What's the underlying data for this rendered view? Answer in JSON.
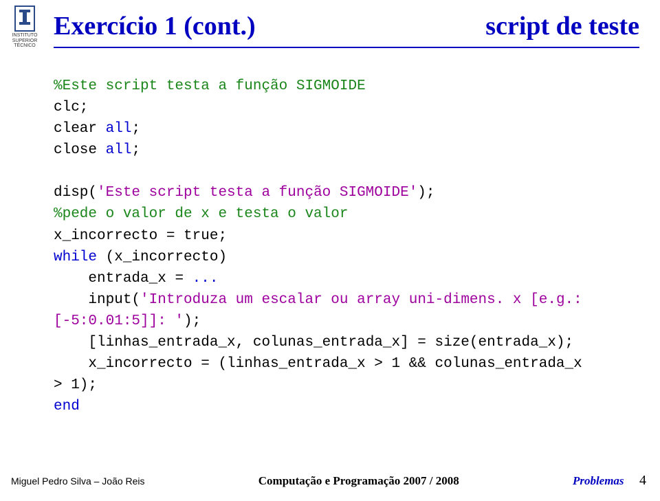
{
  "logo_text": "INSTITUTO SUPERIOR TÉCNICO",
  "title_left": "Exercício 1 (cont.)",
  "title_right": "script de teste",
  "code": {
    "c1": "%Este script testa a função SIGMOIDE",
    "l2": "clc;",
    "l3": "clear ",
    "kw_all1": "all",
    "l3b": ";",
    "l4": "close ",
    "kw_all2": "all",
    "l4b": ";",
    "l6a": "disp(",
    "str1": "'Este script testa a função SIGMOIDE'",
    "l6b": ");",
    "c2": "%pede o valor de x e testa o valor",
    "l8": "x_incorrecto = true;",
    "kw_while": "while",
    "l9": " (x_incorrecto)",
    "l10": "    entrada_x = ",
    "kw_dots": "...",
    "l11a": "    input(",
    "str2": "'Introduza um escalar ou array uni-dimens. x [e.g.: [-5:0.01:5]]: '",
    "l11b": ");",
    "l12": "    [linhas_entrada_x, colunas_entrada_x] = size(entrada_x);",
    "l13": "    x_incorrecto = (linhas_entrada_x > 1 && colunas_entrada_x > 1);",
    "kw_end": "end"
  },
  "footer": {
    "left": "Miguel Pedro Silva – João Reis",
    "center": "Computação e Programação 2007 / 2008",
    "right_label": "Problemas",
    "page": "4"
  }
}
